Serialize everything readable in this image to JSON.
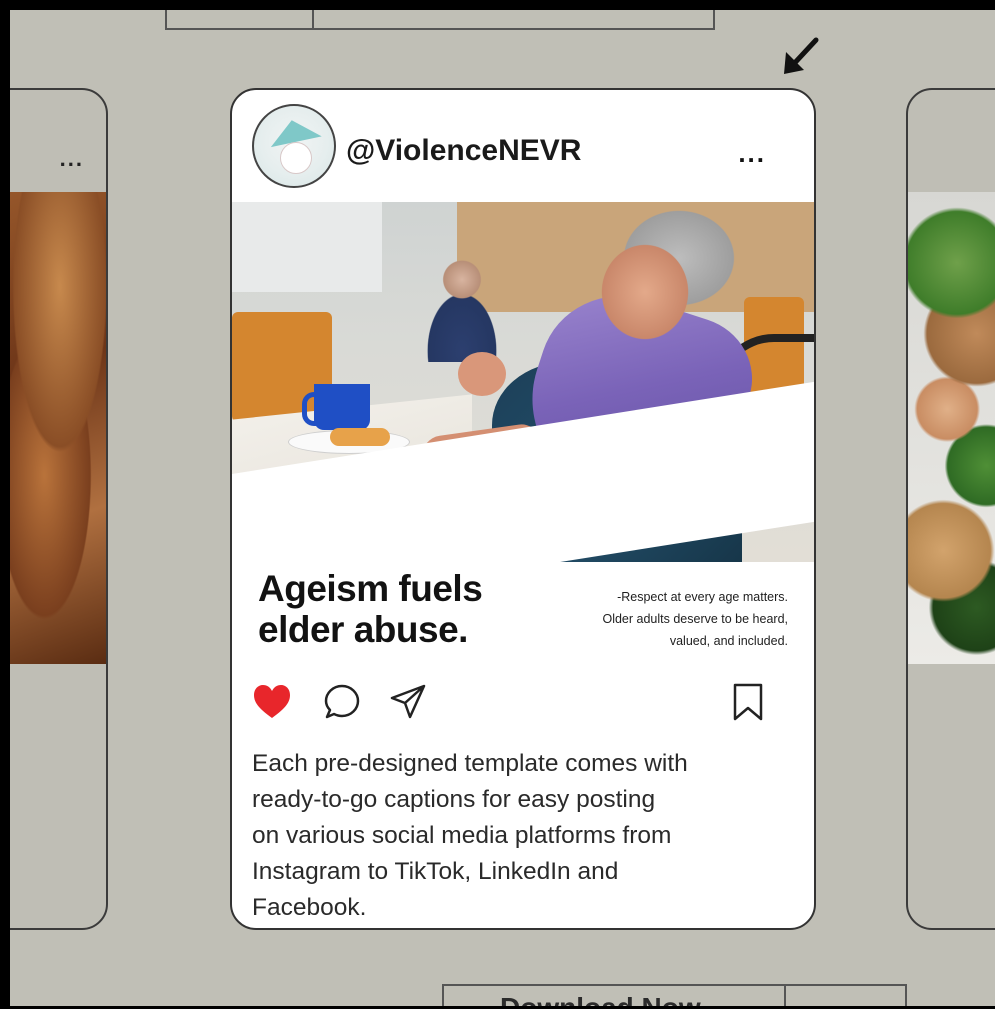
{
  "post": {
    "username": "@ViolenceNEVR",
    "more_label": "...",
    "headline_lines": [
      "Ageism fuels",
      "elder abuse."
    ],
    "subtext_lines": [
      "-Respect at every age matters.",
      "Older adults deserve to be heard,",
      "valued, and included."
    ],
    "caption_lines": [
      "Each pre-designed template comes with",
      "ready-to-go captions for easy posting",
      "on various social media platforms from",
      "Instagram to TikTok, LinkedIn and",
      "Facebook."
    ],
    "liked": true,
    "icons": [
      "heart-icon",
      "comment-icon",
      "share-icon",
      "bookmark-icon"
    ]
  },
  "side_cards": {
    "left_more_label": "..."
  },
  "bottom": {
    "download_label": "Download Now",
    "secondary_label": "..."
  },
  "colors": {
    "background": "#c0bfb6",
    "card": "#ffffff",
    "like": "#e8262b",
    "frame": "#000000"
  }
}
